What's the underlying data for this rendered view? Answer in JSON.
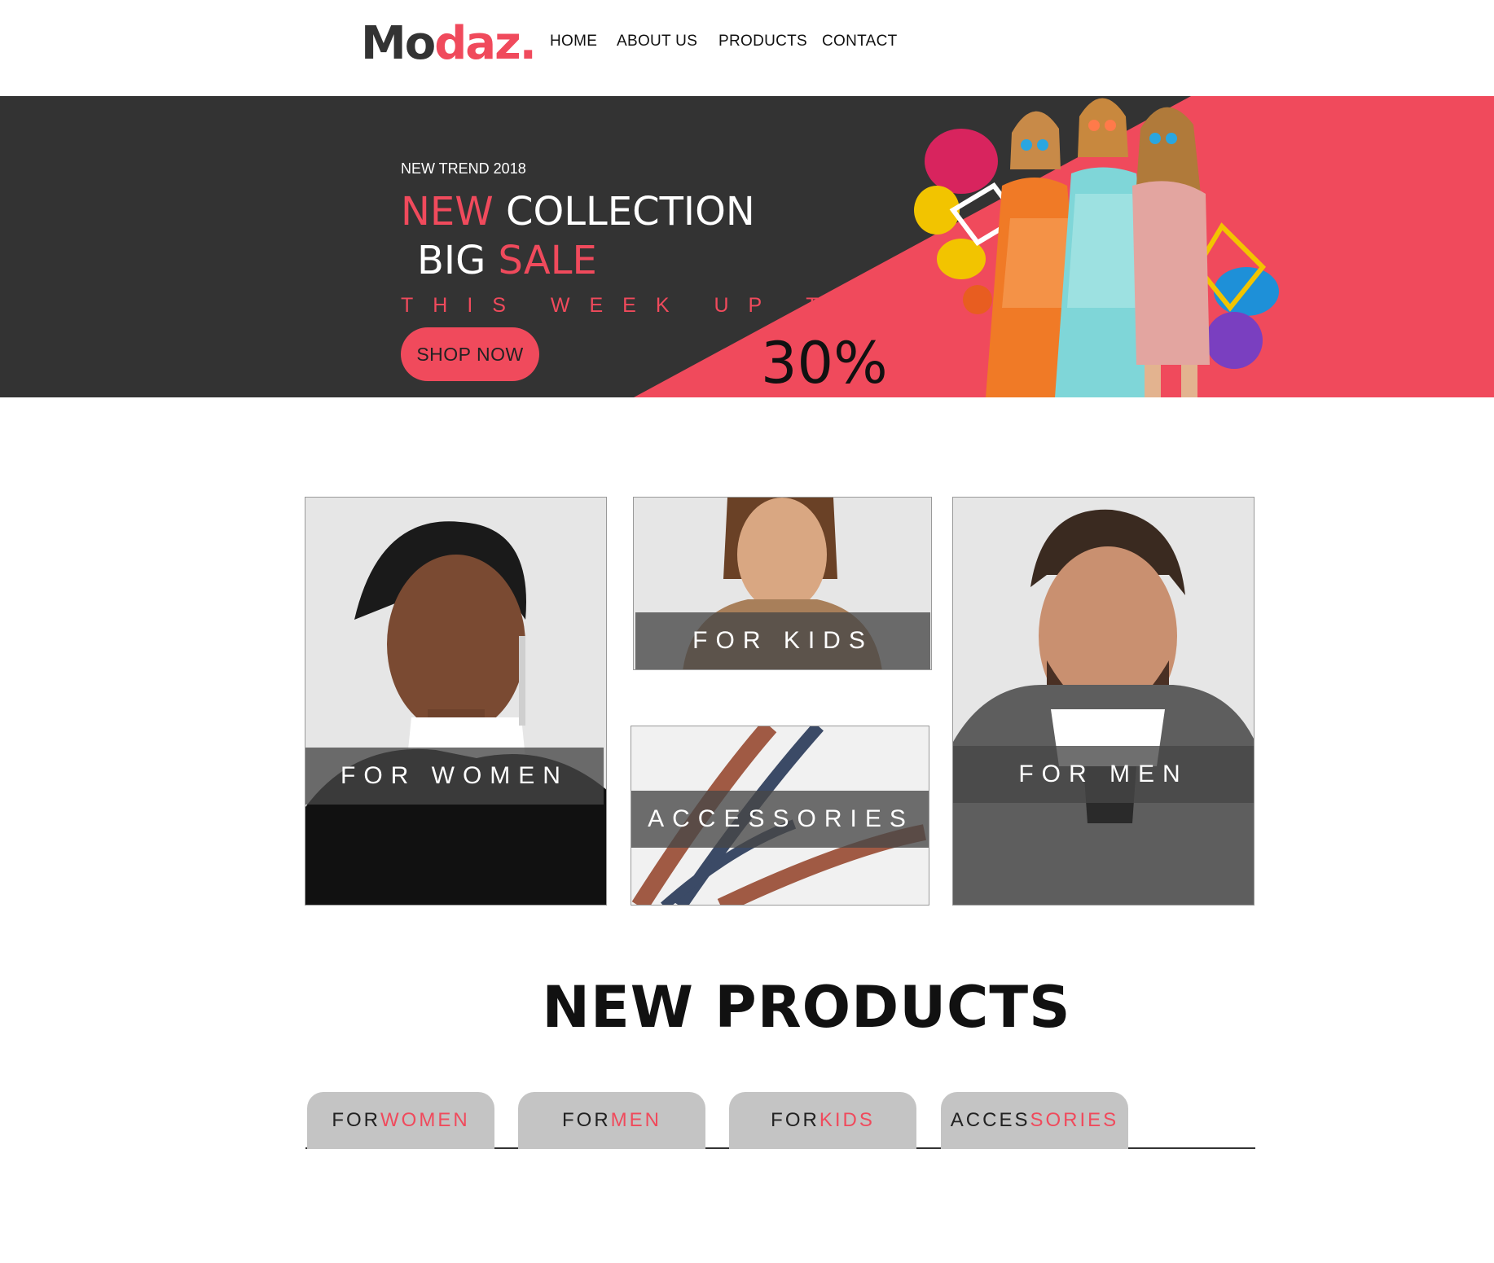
{
  "header": {
    "logo_part1": "Mo",
    "logo_part2": "daz.",
    "nav": [
      "HOME",
      "ABOUT US",
      "PRODUCTS",
      "CONTACT"
    ]
  },
  "hero": {
    "kicker": "NEW TREND 2018",
    "line1_a": "NEW",
    "line1_b": "COLLECTION",
    "line2_a": "BIG",
    "line2_b": "SALE",
    "week": "THIS WEEK UP TO",
    "button": "SHOP NOW",
    "percent": "30%"
  },
  "categories": {
    "women": "FOR WOMEN",
    "kids": "FOR KIDS",
    "accessories": "ACCESSORIES",
    "men": "FOR MEN"
  },
  "new_products": {
    "title": "NEW PRODUCTS",
    "tabs": [
      {
        "a": "FOR ",
        "b": "WOMEN"
      },
      {
        "a": "FOR ",
        "b": "MEN"
      },
      {
        "a": "FOR ",
        "b": "KIDS"
      },
      {
        "a": "ACCES",
        "b": "SORIES"
      }
    ]
  },
  "colors": {
    "accent": "#f04a5c",
    "dark": "#333333",
    "tab_bg": "#c4c4c4"
  }
}
